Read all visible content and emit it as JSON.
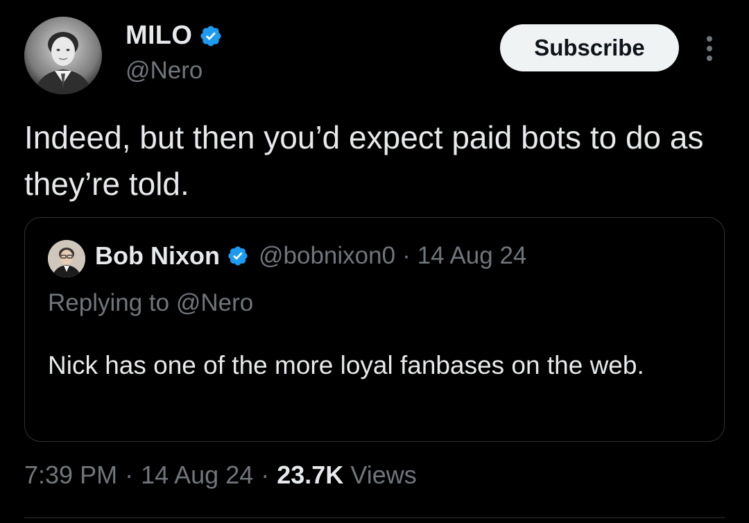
{
  "author": {
    "name": "MILO",
    "handle": "@Nero",
    "verified": true
  },
  "header": {
    "subscribe_label": "Subscribe",
    "more_icon": "more-vertical-icon"
  },
  "tweet": {
    "text": "Indeed, but then you’d expect paid bots to do as they’re told."
  },
  "quote": {
    "author_name": "Bob Nixon",
    "author_handle": "@bobnixon0",
    "separator": "·",
    "date": "14 Aug 24",
    "replying_prefix": "Replying to",
    "replying_handle": "@Nero",
    "text": "Nick has one of the more loyal fanbases on the web."
  },
  "meta": {
    "time": "7:39 PM",
    "separator": "·",
    "date": "14 Aug 24",
    "views_count": "23.7K",
    "views_label": "Views"
  },
  "colors": {
    "background": "#000000",
    "primary_text": "#e7e9ea",
    "secondary_text": "#71767b",
    "border": "#2f3336",
    "verified_blue": "#1d9bf0",
    "button_bg": "#eff3f4"
  }
}
